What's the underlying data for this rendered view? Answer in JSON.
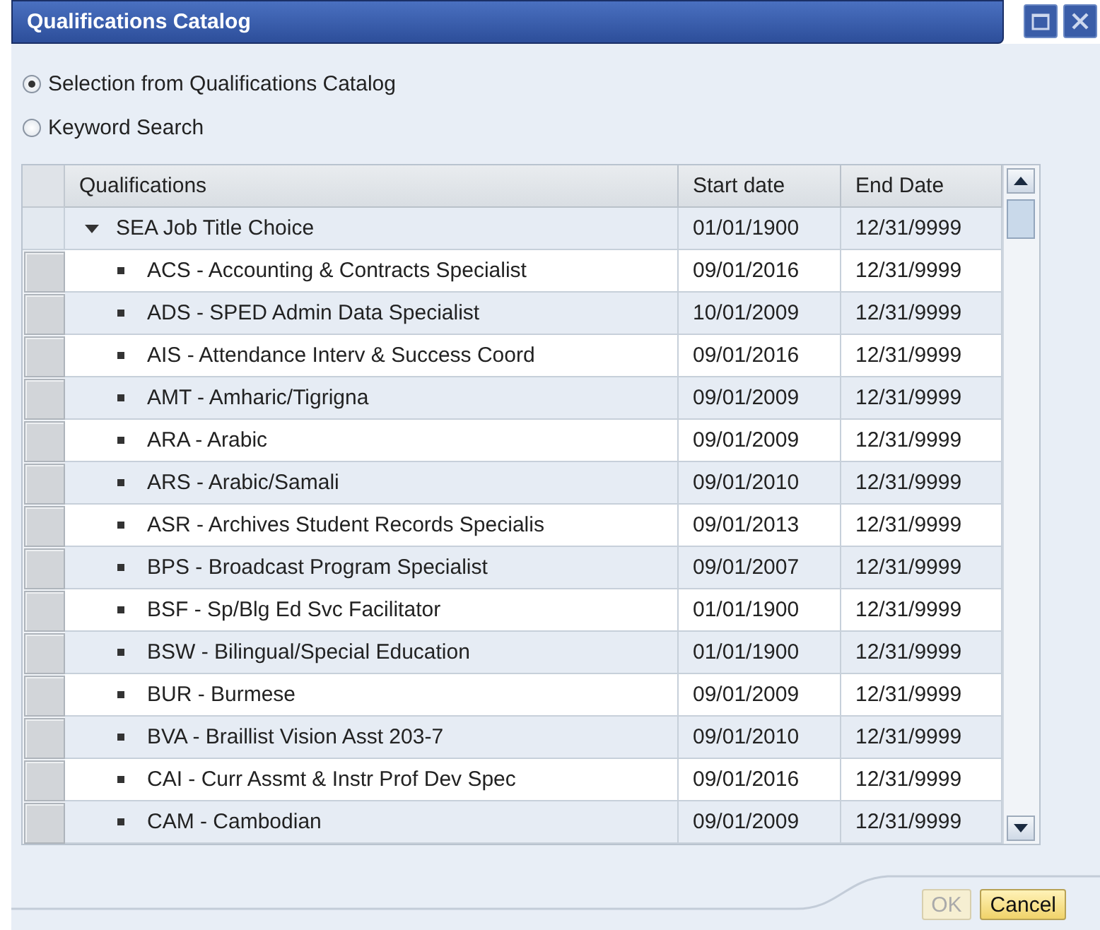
{
  "window": {
    "title": "Qualifications Catalog"
  },
  "options": [
    {
      "label": "Selection from Qualifications Catalog",
      "selected": true
    },
    {
      "label": "Keyword Search",
      "selected": false
    }
  ],
  "table": {
    "columns": [
      "Qualifications",
      "Start date",
      "End Date"
    ],
    "rows": [
      {
        "name": "SEA Job Title Choice",
        "start": "01/01/1900",
        "end": "12/31/9999",
        "expanded": true,
        "children": [
          {
            "name": "ACS - Accounting & Contracts Specialist",
            "start": "09/01/2016",
            "end": "12/31/9999"
          },
          {
            "name": "ADS - SPED Admin Data Specialist",
            "start": "10/01/2009",
            "end": "12/31/9999"
          },
          {
            "name": "AIS - Attendance Interv & Success Coord",
            "start": "09/01/2016",
            "end": "12/31/9999"
          },
          {
            "name": "AMT - Amharic/Tigrigna",
            "start": "09/01/2009",
            "end": "12/31/9999"
          },
          {
            "name": "ARA - Arabic",
            "start": "09/01/2009",
            "end": "12/31/9999"
          },
          {
            "name": "ARS - Arabic/Samali",
            "start": "09/01/2010",
            "end": "12/31/9999"
          },
          {
            "name": "ASR - Archives Student Records Specialis",
            "start": "09/01/2013",
            "end": "12/31/9999"
          },
          {
            "name": "BPS - Broadcast Program Specialist",
            "start": "09/01/2007",
            "end": "12/31/9999"
          },
          {
            "name": "BSF - Sp/Blg Ed Svc Facilitator",
            "start": "01/01/1900",
            "end": "12/31/9999"
          },
          {
            "name": "BSW - Bilingual/Special Education",
            "start": "01/01/1900",
            "end": "12/31/9999"
          },
          {
            "name": "BUR - Burmese",
            "start": "09/01/2009",
            "end": "12/31/9999"
          },
          {
            "name": "BVA - Braillist Vision Asst 203-7",
            "start": "09/01/2010",
            "end": "12/31/9999"
          },
          {
            "name": "CAI - Curr Assmt & Instr Prof Dev Spec",
            "start": "09/01/2016",
            "end": "12/31/9999"
          },
          {
            "name": "CAM - Cambodian",
            "start": "09/01/2009",
            "end": "12/31/9999"
          }
        ]
      }
    ]
  },
  "buttons": [
    {
      "label": "OK",
      "disabled": true
    },
    {
      "label": "Cancel",
      "disabled": false
    }
  ]
}
